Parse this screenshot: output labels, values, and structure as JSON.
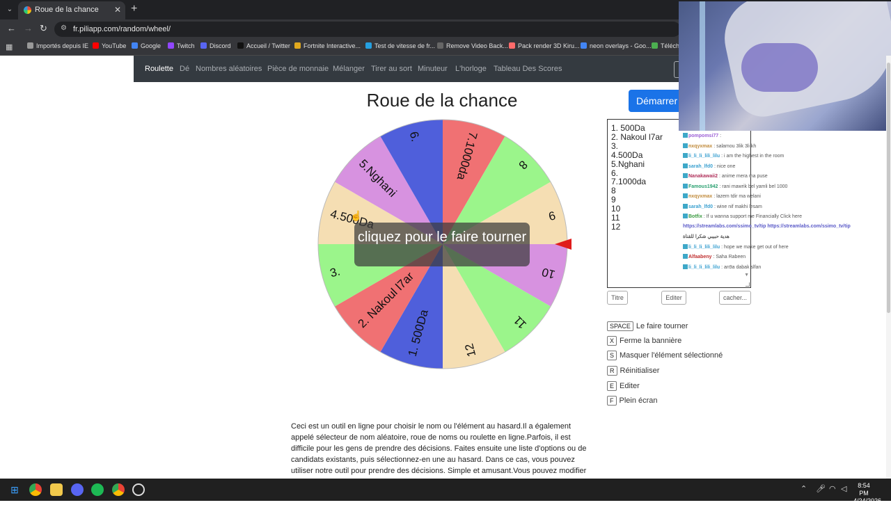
{
  "browser": {
    "tab_title": "Roue de la chance",
    "url": "fr.piliapp.com/random/wheel/",
    "bookmarks": [
      {
        "label": "Importés depuis IE",
        "color": "#999999"
      },
      {
        "label": "YouTube",
        "color": "#ff0000"
      },
      {
        "label": "Google",
        "color": "#4285f4"
      },
      {
        "label": "Twitch",
        "color": "#9146ff"
      },
      {
        "label": "Discord",
        "color": "#5865f2"
      },
      {
        "label": "Accueil / Twitter",
        "color": "#111111"
      },
      {
        "label": "Fortnite Interactive...",
        "color": "#e0a81e"
      },
      {
        "label": "Test de vitesse de fr...",
        "color": "#25a0e0"
      },
      {
        "label": "Remove Video Back...",
        "color": "#666666"
      },
      {
        "label": "Pack render 3D Kiru...",
        "color": "#ff6b6b"
      },
      {
        "label": "neon overlays - Goo...",
        "color": "#4285f4"
      },
      {
        "label": "Téléch",
        "color": "#4caf50"
      }
    ]
  },
  "site_nav": {
    "items": [
      "Roulette",
      "Dé",
      "Nombres aléatoires",
      "Pièce de monnaie",
      "Mélanger",
      "Tirer au sort",
      "Minuteur",
      "L'horloge",
      "Tableau Des Scores"
    ],
    "active": "Roulette"
  },
  "page": {
    "title": "Roue de la chance",
    "start_button": "Démarrer",
    "overlay_text": "cliquez pour le faire tourner"
  },
  "wheel": {
    "segments": [
      {
        "label": "1. 500Da",
        "color": "#4f5fdb"
      },
      {
        "label": "2. Nakoul l7ar",
        "color": "#f07173"
      },
      {
        "label": "3.",
        "color": "#9bf58b"
      },
      {
        "label": "4.500Da",
        "color": "#f5deb3"
      },
      {
        "label": "5.Nghani",
        "color": "#d792e0"
      },
      {
        "label": "6.",
        "color": "#4f5fdb"
      },
      {
        "label": "7.1000da",
        "color": "#f07173"
      },
      {
        "label": "8",
        "color": "#9bf58b"
      },
      {
        "label": "9",
        "color": "#f5deb3"
      },
      {
        "label": "10",
        "color": "#d792e0"
      },
      {
        "label": "11",
        "color": "#9bf58b"
      },
      {
        "label": "12",
        "color": "#f5deb3"
      }
    ]
  },
  "textarea": {
    "lines": [
      "1. 500Da",
      "2. Nakoul l7ar",
      "3.",
      "4.500Da",
      "5.Nghani",
      "6.",
      "7.1000da",
      "8",
      "9",
      "10",
      "11",
      "12"
    ]
  },
  "buttons": {
    "titre": "Titre",
    "editer": "Editer",
    "cacher": "cacher..."
  },
  "hotkeys": [
    {
      "key": "SPACE",
      "label": "Le faire tourner"
    },
    {
      "key": "X",
      "label": "Ferme la bannière"
    },
    {
      "key": "S",
      "label": "Masquer l'élément sélectionné"
    },
    {
      "key": "R",
      "label": "Réinitialiser"
    },
    {
      "key": "E",
      "label": "Editer"
    },
    {
      "key": "F",
      "label": "Plein écran"
    }
  ],
  "description": "Ceci est un outil en ligne pour choisir le nom ou l'élément au hasard.Il a également appelé sélecteur de nom aléatoire, roue de noms ou roulette en ligne.Parfois, il est difficile pour les gens de prendre des décisions. Faites ensuite une liste d'options ou de candidats existants, puis sélectionnez-en une au hasard. Dans ce cas, vous pouvez utiliser notre outil pour prendre des décisions. Simple et amusant.Vous pouvez modifier les noms dans textarea,",
  "chat": [
    {
      "user": "pompomsi77",
      "msg": "",
      "color": "#9c5fd6"
    },
    {
      "user": "nxqyxmax",
      "msg": "salamou 3lik 3li kh",
      "color": "#c08a3a"
    },
    {
      "user": "li_li_li_lili_lilu",
      "msg": "i am the highest in the room",
      "color": "#3aa0d0"
    },
    {
      "user": "sarah_lfd0",
      "msg": "nice one",
      "color": "#3aa0d0"
    },
    {
      "user": "Nanakawaii2",
      "msg": "anime mera ma puse",
      "color": "#b0305a"
    },
    {
      "user": "Famous1942",
      "msg": "rani mawrik bel yamli bel 1000",
      "color": "#2aa070"
    },
    {
      "user": "nxqyxmax",
      "msg": "lazem tdir ma welani",
      "color": "#c08a3a"
    },
    {
      "user": "sarah_lfd0",
      "msg": "wine nif makhi lesam",
      "color": "#3aa0d0"
    },
    {
      "user": "Botfix",
      "msg": "If u wanna support me Financially Click here",
      "color": "#3a9a40"
    },
    {
      "user": "",
      "msg": "https://streamlabs.com/ssimo_tv/tip https://streamlabs.com/ssimo_tv/tip",
      "color": "#5a5ac8"
    },
    {
      "user": "",
      "msg": "هدية حبيبي شكرا للقناة",
      "color": "#555555"
    },
    {
      "user": "li_li_li_lili_lilu",
      "msg": "hope we make get out of here",
      "color": "#3aa0d0"
    },
    {
      "user": "Alfaabeny",
      "msg": "Saha Rabeen",
      "color": "#c03030"
    },
    {
      "user": "li_li_li_lili_lilu",
      "msg": "an9a dabak slfan",
      "color": "#3aa0d0"
    }
  ],
  "taskbar": {
    "time": "8:54 PM",
    "date": "4/24/2026"
  }
}
